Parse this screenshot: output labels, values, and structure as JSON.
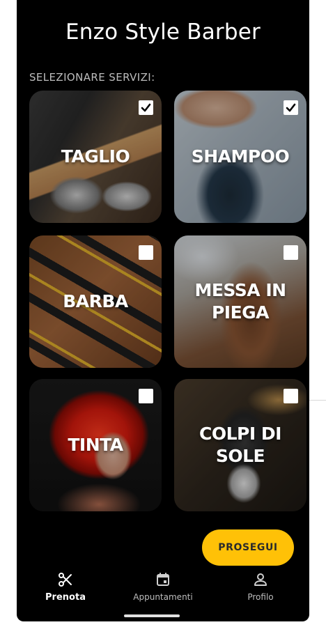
{
  "app": {
    "title": "Enzo Style Barber",
    "section_label": "SELEZIONARE SERVIZI:"
  },
  "services": [
    {
      "label": "TAGLIO",
      "selected": true
    },
    {
      "label": "SHAMPOO",
      "selected": true
    },
    {
      "label": "BARBA",
      "selected": false
    },
    {
      "label": "MESSA IN PIEGA",
      "selected": false
    },
    {
      "label": "TINTA",
      "selected": false
    },
    {
      "label": "COLPI DI SOLE",
      "selected": false
    }
  ],
  "cta": {
    "label": "PROSEGUI"
  },
  "nav": {
    "items": [
      {
        "label": "Prenota",
        "icon": "scissors-icon",
        "active": true
      },
      {
        "label": "Appuntamenti",
        "icon": "calendar-icon",
        "active": false
      },
      {
        "label": "Profilo",
        "icon": "person-icon",
        "active": false
      }
    ]
  },
  "colors": {
    "background": "#000000",
    "accent": "#ffc107",
    "text": "#ffffff",
    "muted": "#bdbdbd"
  }
}
